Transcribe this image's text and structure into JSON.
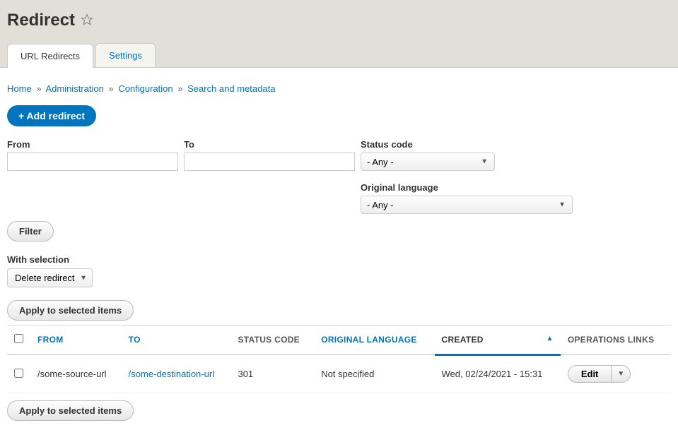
{
  "page": {
    "title": "Redirect"
  },
  "tabs": {
    "redirects": "URL Redirects",
    "settings": "Settings"
  },
  "breadcrumbs": {
    "home": "Home",
    "admin": "Administration",
    "config": "Configuration",
    "search": "Search and metadata",
    "sep": "»"
  },
  "actions": {
    "add": "+ Add redirect"
  },
  "filters": {
    "from_label": "From",
    "to_label": "To",
    "status_label": "Status code",
    "status_value": "- Any -",
    "lang_label": "Original language",
    "lang_value": "- Any -",
    "filter_btn": "Filter"
  },
  "bulk": {
    "label": "With selection",
    "action_value": "Delete redirect",
    "apply": "Apply to selected items"
  },
  "table": {
    "headers": {
      "from": "FROM",
      "to": "TO",
      "status": "STATUS CODE",
      "lang": "ORIGINAL LANGUAGE",
      "created": "CREATED",
      "ops": "OPERATIONS LINKS"
    },
    "rows": [
      {
        "from": "/some-source-url",
        "to": "/some-destination-url",
        "status": "301",
        "lang": "Not specified",
        "created": "Wed, 02/24/2021 - 15:31",
        "edit": "Edit"
      }
    ]
  }
}
